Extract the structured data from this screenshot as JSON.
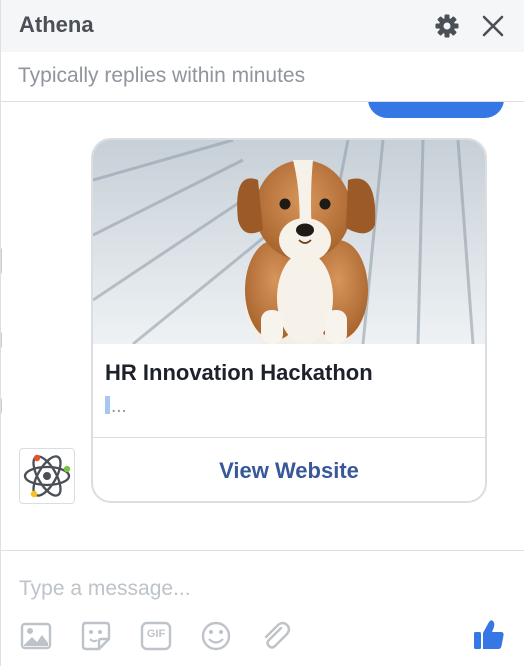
{
  "header": {
    "title": "Athena",
    "settings_icon": "gear-icon",
    "close_icon": "close-icon"
  },
  "status": {
    "text": "Typically replies within minutes"
  },
  "card": {
    "image": "puppy-photo",
    "headline": "HR Innovation Hackathon",
    "subtitle": "...",
    "button_label": "View Website"
  },
  "sender": {
    "avatar": "atom-logo"
  },
  "composer": {
    "placeholder": "Type a message...",
    "tools": [
      "image-icon",
      "sticker-icon",
      "gif-icon",
      "emoji-icon",
      "attachment-icon"
    ],
    "gif_label": "GIF",
    "like_icon": "thumbs-up-icon"
  },
  "colors": {
    "accent": "#3578e5",
    "link": "#385898",
    "header_bg": "#f5f6f7",
    "muted_text": "#90949c"
  }
}
